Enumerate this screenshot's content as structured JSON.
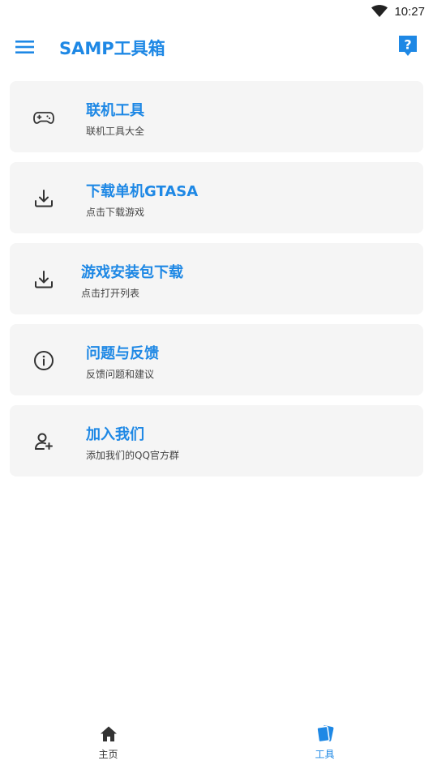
{
  "status_bar": {
    "time": "10:27",
    "wifi_icon": "wifi-icon"
  },
  "app_bar": {
    "title": "SAMP工具箱",
    "menu_icon": "hamburger-menu-icon",
    "help_icon": "help-question-icon",
    "accent_color": "#1e88e5"
  },
  "tools": [
    {
      "title": "联机工具",
      "subtitle": "联机工具大全",
      "icon": "gamepad-icon"
    },
    {
      "title": "下载单机GTASA",
      "subtitle": "点击下载游戏",
      "icon": "download-icon"
    },
    {
      "title": "游戏安装包下载",
      "subtitle": "点击打开列表",
      "icon": "download-icon"
    },
    {
      "title": "问题与反馈",
      "subtitle": "反馈问题和建议",
      "icon": "info-icon"
    },
    {
      "title": "加入我们",
      "subtitle": "添加我们的QQ官方群",
      "icon": "add-user-icon"
    }
  ],
  "bottom_nav": {
    "home": {
      "label": "主页",
      "icon": "home-icon"
    },
    "tools": {
      "label": "工具",
      "icon": "cards-icon",
      "active": true
    }
  }
}
